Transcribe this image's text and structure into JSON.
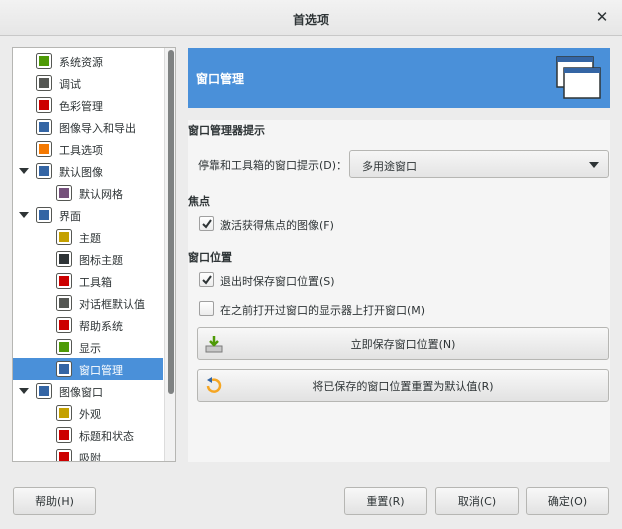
{
  "window": {
    "title": "首选项"
  },
  "sidebar": {
    "items": [
      {
        "label": "系统资源",
        "icon": "system-resources-icon",
        "indent": 0,
        "expanded": null
      },
      {
        "label": "调试",
        "icon": "debug-icon",
        "indent": 0,
        "expanded": null
      },
      {
        "label": "色彩管理",
        "icon": "color-management-icon",
        "indent": 0,
        "expanded": null
      },
      {
        "label": "图像导入和导出",
        "icon": "image-import-export-icon",
        "indent": 0,
        "expanded": null
      },
      {
        "label": "工具选项",
        "icon": "tool-options-icon",
        "indent": 0,
        "expanded": null
      },
      {
        "label": "默认图像",
        "icon": "default-image-icon",
        "indent": 0,
        "expanded": true
      },
      {
        "label": "默认网格",
        "icon": "default-grid-icon",
        "indent": 1,
        "expanded": null
      },
      {
        "label": "界面",
        "icon": "interface-icon",
        "indent": 0,
        "expanded": true
      },
      {
        "label": "主题",
        "icon": "theme-icon",
        "indent": 1,
        "expanded": null
      },
      {
        "label": "图标主题",
        "icon": "icon-theme-icon",
        "indent": 1,
        "expanded": null
      },
      {
        "label": "工具箱",
        "icon": "toolbox-icon",
        "indent": 1,
        "expanded": null
      },
      {
        "label": "对话框默认值",
        "icon": "dialog-defaults-icon",
        "indent": 1,
        "expanded": null
      },
      {
        "label": "帮助系统",
        "icon": "help-system-icon",
        "indent": 1,
        "expanded": null
      },
      {
        "label": "显示",
        "icon": "display-icon",
        "indent": 1,
        "expanded": null
      },
      {
        "label": "窗口管理",
        "icon": "window-management-icon",
        "indent": 1,
        "expanded": null,
        "selected": true
      },
      {
        "label": "图像窗口",
        "icon": "image-window-icon",
        "indent": 0,
        "expanded": true
      },
      {
        "label": "外观",
        "icon": "appearance-icon",
        "indent": 1,
        "expanded": null
      },
      {
        "label": "标题和状态",
        "icon": "title-status-icon",
        "indent": 1,
        "expanded": null
      },
      {
        "label": "吸附",
        "icon": "snapping-icon",
        "indent": 1,
        "expanded": null
      }
    ]
  },
  "page": {
    "title": "窗口管理",
    "icon": "window-management-icon"
  },
  "sections": {
    "wm_hints": {
      "title": "窗口管理器提示",
      "hint_label": "停靠和工具箱的窗口提示(D)：",
      "hint_value": "多用途窗口"
    },
    "focus": {
      "title": "焦点",
      "activate_label": "激活获得焦点的图像(F)",
      "activate_checked": true
    },
    "window_pos": {
      "title": "窗口位置",
      "save_on_exit_label": "退出时保存窗口位置(S)",
      "save_on_exit_checked": true,
      "open_on_monitor_label": "在之前打开过窗口的显示器上打开窗口(M)",
      "open_on_monitor_checked": false,
      "save_now_label": "立即保存窗口位置(N)",
      "reset_label": "将已保存的窗口位置重置为默认值(R)"
    }
  },
  "footer": {
    "help": "帮助(H)",
    "reset": "重置(R)",
    "cancel": "取消(C)",
    "ok": "确定(O)"
  },
  "colors": {
    "accent": "#4a90d9",
    "background": "#ececec"
  }
}
